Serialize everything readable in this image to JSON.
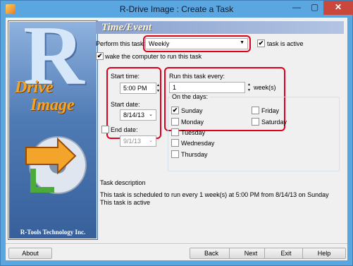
{
  "window": {
    "title": "R-Drive Image : Create a Task",
    "minimize_glyph": "—",
    "maximize_glyph": "▢",
    "close_glyph": "✕",
    "app_icon": "r-drive-app-icon"
  },
  "branding": {
    "letter": "R",
    "line1": "Drive",
    "line2": "Image",
    "company": "R-Tools Technology Inc."
  },
  "header": {
    "title": "Time/Event"
  },
  "perform": {
    "label": "Perform this task:",
    "value": "Weekly",
    "active_label": "task is active",
    "active_checked": true
  },
  "wake": {
    "label": "wake the computer to run this task",
    "checked": true
  },
  "start_time": {
    "label": "Start time:",
    "value": "5:00 PM"
  },
  "start_date": {
    "label": "Start date:",
    "value": "8/14/13"
  },
  "end_date": {
    "label": "End date:",
    "value": "9/1/13",
    "checked": false
  },
  "repeat": {
    "label": "Run this task every:",
    "value": "1",
    "unit": "week(s)"
  },
  "days": {
    "group_title": "On the days:",
    "items": [
      {
        "label": "Sunday",
        "checked": true
      },
      {
        "label": "Monday",
        "checked": false
      },
      {
        "label": "Tuesday",
        "checked": false
      },
      {
        "label": "Wednesday",
        "checked": false
      },
      {
        "label": "Thursday",
        "checked": false
      },
      {
        "label": "Friday",
        "checked": false
      },
      {
        "label": "Saturday",
        "checked": false
      }
    ]
  },
  "description": {
    "title": "Task description",
    "line1": "This task is scheduled to run every 1 week(s) at 5:00 PM from 8/14/13 on Sunday",
    "line2": "This task is active"
  },
  "buttons": {
    "about": "About",
    "back": "Back",
    "next": "Next",
    "exit": "Exit",
    "help": "Help"
  },
  "colors": {
    "highlight": "#e0001b",
    "titlebar": "#5aa6e1",
    "close": "#c9473b"
  }
}
